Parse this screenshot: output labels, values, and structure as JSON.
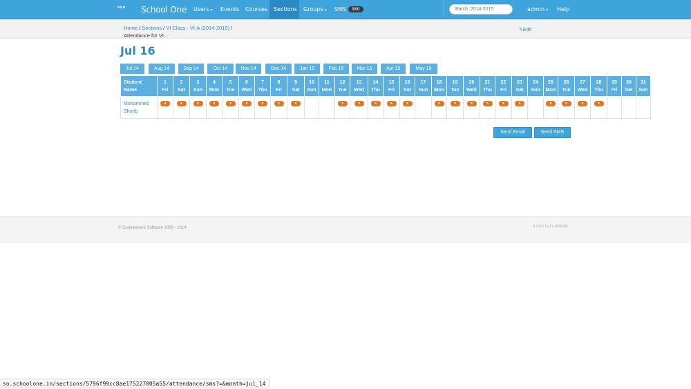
{
  "nav": {
    "brand": "School One",
    "items": [
      {
        "label": "Users",
        "caret": true,
        "active": false
      },
      {
        "label": "Events",
        "caret": false,
        "active": false
      },
      {
        "label": "Courses",
        "caret": false,
        "active": false
      },
      {
        "label": "Sections",
        "caret": false,
        "active": true
      },
      {
        "label": "Groups",
        "caret": true,
        "active": false
      },
      {
        "label": "SMS",
        "caret": false,
        "active": false,
        "badge": "980"
      }
    ],
    "batch_placeholder": "Batch :2014-2015",
    "admin_label": "admin",
    "help_label": "Help"
  },
  "breadcrumb": {
    "home": "Home",
    "sections": "Sections",
    "section_name": "VI Class - VI-A (2014-2015)",
    "current": "Attendance for VI...",
    "edit": "Edit"
  },
  "title": "Jul 16",
  "months": [
    "Jul 14",
    "Aug 14",
    "Sep 14",
    "Oct 14",
    "Nov 14",
    "Dec 14",
    "Jan 15",
    "Feb 15",
    "Mar 15",
    "Apr 15",
    "May 15"
  ],
  "table": {
    "student_header": [
      "Student",
      "Name"
    ],
    "days": [
      {
        "n": "1",
        "d": "Fri"
      },
      {
        "n": "2",
        "d": "Sat"
      },
      {
        "n": "3",
        "d": "Sun"
      },
      {
        "n": "4",
        "d": "Mon"
      },
      {
        "n": "5",
        "d": "Tue"
      },
      {
        "n": "6",
        "d": "Wed"
      },
      {
        "n": "7",
        "d": "Thu"
      },
      {
        "n": "8",
        "d": "Fri"
      },
      {
        "n": "9",
        "d": "Sat"
      },
      {
        "n": "10",
        "d": "Sun"
      },
      {
        "n": "11",
        "d": "Mon"
      },
      {
        "n": "12",
        "d": "Tue"
      },
      {
        "n": "13",
        "d": "Wed"
      },
      {
        "n": "14",
        "d": "Thu"
      },
      {
        "n": "15",
        "d": "Fri"
      },
      {
        "n": "16",
        "d": "Sat"
      },
      {
        "n": "17",
        "d": "Sun"
      },
      {
        "n": "18",
        "d": "Mon"
      },
      {
        "n": "19",
        "d": "Tue"
      },
      {
        "n": "20",
        "d": "Wed"
      },
      {
        "n": "21",
        "d": "Thu"
      },
      {
        "n": "22",
        "d": "Fri"
      },
      {
        "n": "23",
        "d": "Sat"
      },
      {
        "n": "24",
        "d": "Sun"
      },
      {
        "n": "25",
        "d": "Mon"
      },
      {
        "n": "26",
        "d": "Tue"
      },
      {
        "n": "27",
        "d": "Wed"
      },
      {
        "n": "28",
        "d": "Thu"
      },
      {
        "n": "29",
        "d": "Fri"
      },
      {
        "n": "30",
        "d": "Sat"
      },
      {
        "n": "31",
        "d": "Sun"
      }
    ],
    "rows": [
      {
        "student": [
          "Mohammed",
          "Shoeb"
        ],
        "marks": [
          "x",
          "x",
          "x",
          "x",
          "x",
          "x",
          "x",
          "x",
          "x",
          "",
          "",
          "x",
          "x",
          "x",
          "x",
          "x",
          "",
          "x",
          "x",
          "x",
          "x",
          "x",
          "x",
          "",
          "x",
          "x",
          "x",
          "x",
          "",
          "",
          ""
        ]
      }
    ]
  },
  "buttons": {
    "send_email": "Send Email",
    "send_sms": "Send SMS"
  },
  "footer": {
    "copyright": "© Coomkevent Software 2009 - 2014",
    "version": "V 2016.16.21 a6553d6"
  },
  "status_url": "so.schoolone.in/sections/5796f99cc8ae175227005a55/attendance/sms?=&month=jul_14",
  "colors": {
    "header": "#3fa3dc",
    "tab": "#5ab0e3",
    "mark": "#e8731d",
    "link": "#2a8ac6"
  }
}
